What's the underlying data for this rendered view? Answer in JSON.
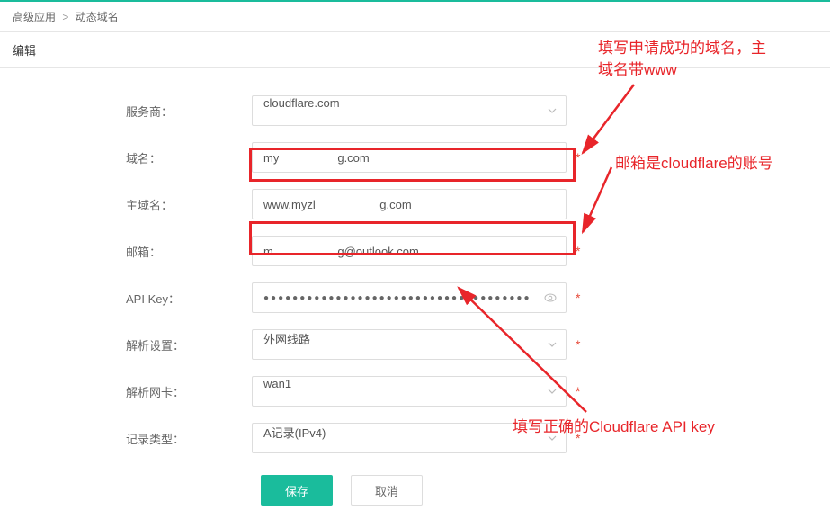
{
  "breadcrumb": {
    "parent": "高级应用",
    "current": "动态域名"
  },
  "page_title": "编辑",
  "labels": {
    "provider": "服务商：",
    "domain": "域名：",
    "main_domain": "主域名：",
    "email": "邮箱：",
    "api_key": "API Key：",
    "resolve_setting": "解析设置：",
    "resolve_nic": "解析网卡：",
    "record_type": "记录类型："
  },
  "values": {
    "provider": "cloudflare.com",
    "domain_prefix": "my",
    "domain_suffix": "g.com",
    "main_domain_prefix": "www.myzl",
    "main_domain_suffix": "g.com",
    "email_prefix": "m",
    "email_suffix": "g@outlook.com",
    "api_key_mask": "●●●●●●●●●●●●●●●●●●●●●●●●●●●●●●●●●●●●●",
    "resolve_setting": "外网线路",
    "resolve_nic": "wan1",
    "record_type": "A记录(IPv4)"
  },
  "required": "*",
  "actions": {
    "save": "保存",
    "cancel": "取消"
  },
  "annotations": {
    "a1_line1": "填写申请成功的域名，主",
    "a1_line2": "域名带www",
    "a2": "邮箱是cloudflare的账号",
    "a3": "填写正确的Cloudflare API key"
  }
}
